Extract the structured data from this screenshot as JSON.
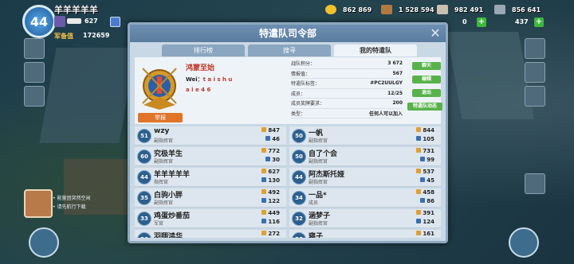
{
  "player": {
    "level": "44",
    "name": "羊羊羊羊羊",
    "trophies": "627",
    "military_label": "军备值",
    "military_value": "172659"
  },
  "resources": {
    "gold": "862 869",
    "wood": "1 528 594",
    "stone": "982 491",
    "iron": "856 641",
    "diamonds_a": "0",
    "diamonds_b": "437"
  },
  "dialog": {
    "title": "特遣队司令部",
    "tabs": [
      "排行榜",
      "搜寻",
      "我的特遣队"
    ],
    "clan": {
      "name": "鸿蒙至始",
      "desc_prefix": "Wei：",
      "desc_a": "t a i s h u",
      "desc_b": "a i e 4 6",
      "signup": "举报"
    },
    "stats": [
      {
        "label": "战队积分：",
        "value": "3 672"
      },
      {
        "label": "情报值：",
        "value": "567"
      },
      {
        "label": "特遣队标签：",
        "value": "#PC2UULGY"
      },
      {
        "label": "成员：",
        "value": "12/25"
      },
      {
        "label": "成员奖牌要求：",
        "value": "200"
      },
      {
        "label": "类型：",
        "value": "任何人可以加入"
      }
    ],
    "buttons": [
      "聊天",
      "编辑",
      "退出",
      "特遣队动态"
    ]
  },
  "members_left": [
    {
      "level": "51",
      "name": "wzy",
      "rank": "副指挥官",
      "a": "847",
      "b": "46"
    },
    {
      "level": "60",
      "name": "究极羊生",
      "rank": "副指挥官",
      "a": "772",
      "b": "30"
    },
    {
      "level": "44",
      "name": "羊羊羊羊羊",
      "rank": "指挥官",
      "a": "627",
      "b": "130"
    },
    {
      "level": "35",
      "name": "白驹小胖",
      "rank": "副指挥官",
      "a": "492",
      "b": "122"
    },
    {
      "level": "33",
      "name": "鸡蛋炒番茄",
      "rank": "军官",
      "a": "449",
      "b": "116"
    },
    {
      "level": "36",
      "name": "羽翔鸿华",
      "rank": "",
      "a": "272",
      "b": ""
    }
  ],
  "members_right": [
    {
      "level": "50",
      "name": "一帆",
      "rank": "副指挥官",
      "a": "844",
      "b": "105"
    },
    {
      "level": "50",
      "name": "自了个会",
      "rank": "副指挥官",
      "a": "731",
      "b": "99"
    },
    {
      "level": "44",
      "name": "阿杰斯托娅",
      "rank": "副指挥官",
      "a": "537",
      "b": "45"
    },
    {
      "level": "34",
      "name": "一品*",
      "rank": "成员",
      "a": "458",
      "b": "86"
    },
    {
      "level": "32",
      "name": "涵梦子",
      "rank": "副指挥官",
      "a": "391",
      "b": "124"
    },
    {
      "level": "26",
      "name": "寝子",
      "rank": "",
      "a": "161",
      "b": ""
    }
  ],
  "chat": {
    "line1": "• 能量团突然空闲",
    "line2": "• 请先航行下载"
  }
}
